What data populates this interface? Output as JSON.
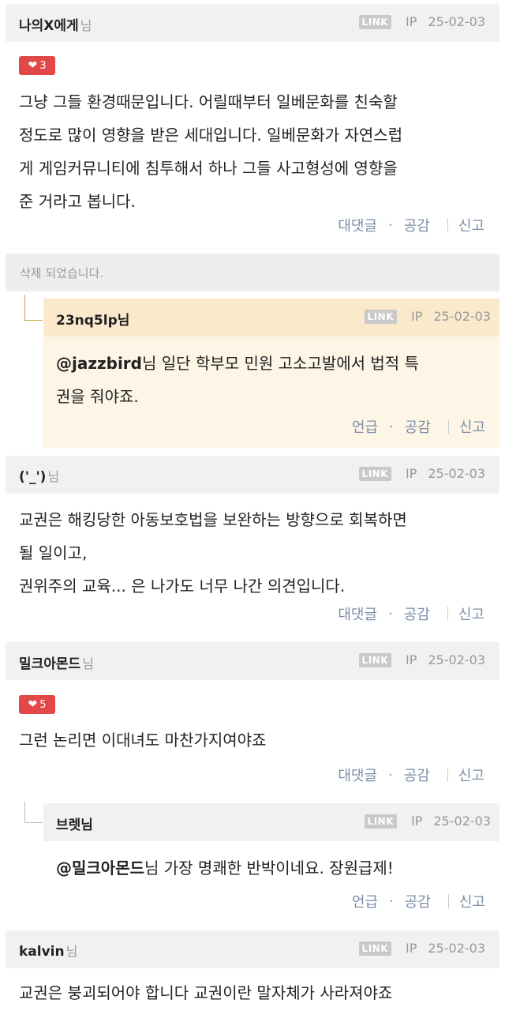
{
  "link_label": "LINK",
  "ip_label": "IP",
  "nim_suffix": "님",
  "action_labels": {
    "reply": "대댓글",
    "mention": "언급",
    "like": "공감",
    "report": "신고"
  },
  "comments": [
    {
      "author": "나의X에게",
      "date": "25-02-03",
      "likes": "3",
      "text": [
        "그냥 그들 환경때문입니다. 어릴때부터 일베문화를 친숙할",
        "정도로 많이 영향을 받은 세대입니다. 일베문화가 자연스럽",
        "게 게임커뮤니티에 침투해서 하나 그들 사고형성에 영향을",
        "준 거라고 봅니다."
      ]
    },
    {
      "deleted_text": "삭제 되었습니다."
    },
    {
      "author": "23nq5lp",
      "date": "25-02-03",
      "mention": "@jazzbird",
      "text": [
        "님 일단 학부모 민원 고소고발에서 법적 특",
        "권을 줘야죠."
      ]
    },
    {
      "author": "('_')",
      "date": "25-02-03",
      "text": [
        "교권은 해킹당한 아동보호법을 보완하는 방향으로 회복하면",
        "될 일이고,",
        "권위주의 교육... 은 나가도 너무 나간 의견입니다."
      ]
    },
    {
      "author": "밀크아몬드",
      "date": "25-02-03",
      "likes": "5",
      "text": [
        "그런 논리면 이대녀도 마찬가지여야죠"
      ]
    },
    {
      "author": "브렛",
      "date": "25-02-03",
      "mention": "@밀크아몬드",
      "text": [
        "님 가장 명쾌한 반박이네요. 장원급제!"
      ]
    },
    {
      "author": "kalvin",
      "date": "25-02-03",
      "text": [
        "교권은 붕괴되어야 합니다 교권이란 말자체가 사라져야죠"
      ]
    }
  ],
  "colors": {
    "accent_like": "#e24848",
    "action_text": "#7b8ea6",
    "reply_highlight_bg": "#fdf5e6",
    "reply_highlight_header": "#fbe9cc",
    "header_bg": "#f1f1f1"
  }
}
